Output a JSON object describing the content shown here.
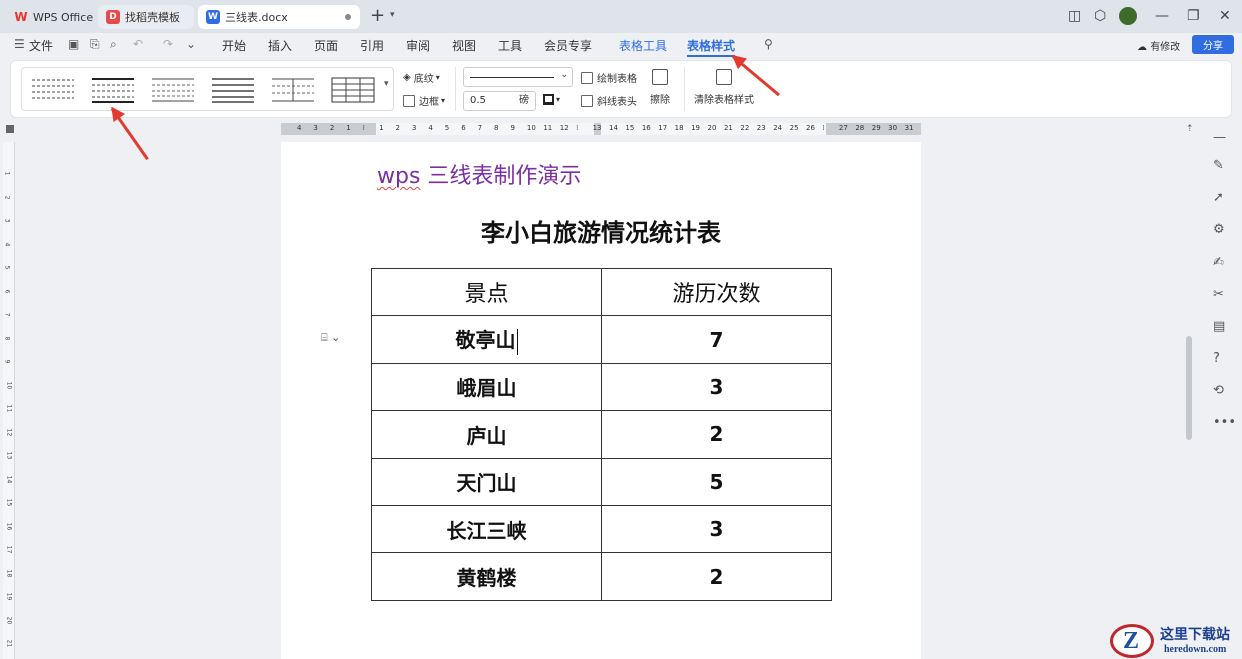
{
  "tabs": {
    "wps_home": "WPS Office",
    "templates": "找稻壳模板",
    "document": "三线表.docx"
  },
  "menubar": {
    "file": "文件",
    "items": [
      "开始",
      "插入",
      "页面",
      "引用",
      "审阅",
      "视图",
      "工具",
      "会员专享",
      "表格工具",
      "表格样式"
    ],
    "revise": "有修改",
    "share": "分享"
  },
  "ribbon": {
    "shading": "底纹",
    "border": "边框",
    "draw_table": "绘制表格",
    "diagonal_header": "斜线表头",
    "erase": "擦除",
    "line_width": "0.5",
    "line_unit": "磅",
    "clear_style": "清除表格样式"
  },
  "ruler": {
    "ticks": [
      "4",
      "3",
      "2",
      "1",
      "",
      "1",
      "2",
      "3",
      "4",
      "5",
      "6",
      "7",
      "8",
      "9",
      "10",
      "11",
      "12",
      "",
      "13",
      "14",
      "15",
      "16",
      "17",
      "18",
      "19",
      "20",
      "21",
      "22",
      "23",
      "24",
      "25",
      "26",
      "",
      "27",
      "28",
      "29",
      "30",
      "31"
    ]
  },
  "vruler_ticks": [
    "1",
    "2",
    "3",
    "4",
    "5",
    "6",
    "7",
    "8",
    "9",
    "10",
    "11",
    "12",
    "13",
    "14",
    "15",
    "16",
    "17",
    "18",
    "19",
    "20",
    "21"
  ],
  "document": {
    "heading": "wps 三线表制作演示",
    "heading_wavy": "wps",
    "heading_rest": " 三线表制作演示",
    "table_title": "李小白旅游情况统计表",
    "table": {
      "headers": [
        "景点",
        "游历次数"
      ],
      "rows": [
        [
          "敬亭山",
          "7"
        ],
        [
          "峨眉山",
          "3"
        ],
        [
          "庐山",
          "2"
        ],
        [
          "天门山",
          "5"
        ],
        [
          "长江三峡",
          "3"
        ],
        [
          "黄鹤楼",
          "2"
        ]
      ]
    }
  },
  "watermark": {
    "title": "这里下载站",
    "url": "heredown.com"
  },
  "colors": {
    "accent": "#2f6de1",
    "heading": "#7b2fa3",
    "arrow": "#e23a2e"
  }
}
